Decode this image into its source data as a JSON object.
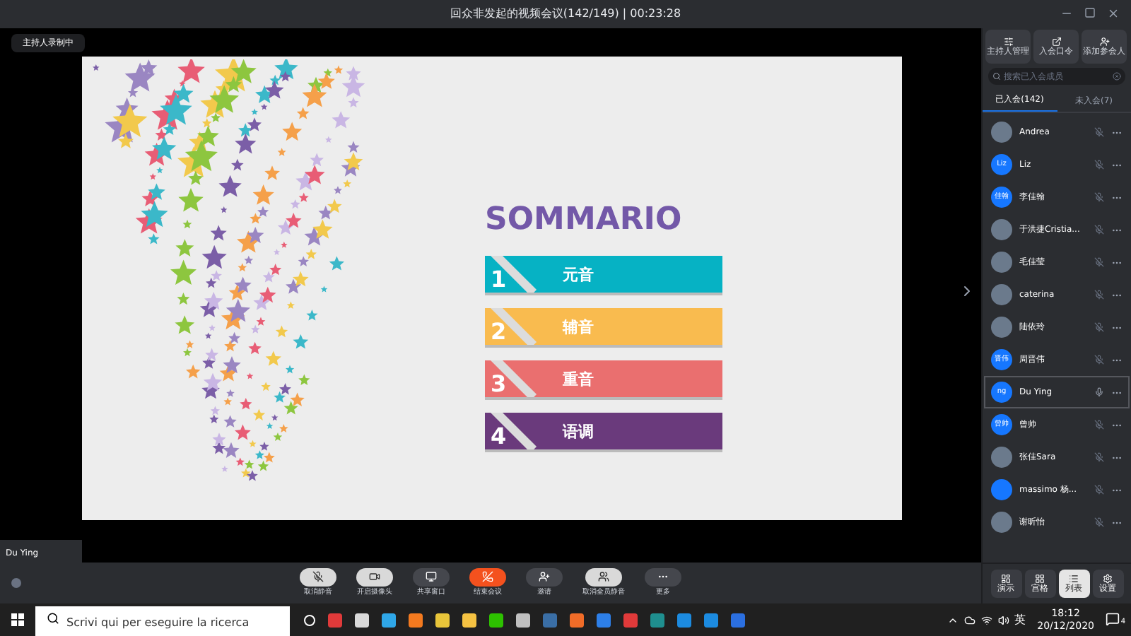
{
  "window": {
    "title": "回众非发起的视频会议(142/149) | 00:23:28"
  },
  "recording_badge": "主持人录制中",
  "slide": {
    "title": "SOMMARIO",
    "items": [
      {
        "number": "1",
        "label": "元音",
        "color": "#06b2c4"
      },
      {
        "number": "2",
        "label": "辅音",
        "color": "#f9bb4f"
      },
      {
        "number": "3",
        "label": "重音",
        "color": "#ea6f6f"
      },
      {
        "number": "4",
        "label": "语调",
        "color": "#6a3a7c"
      }
    ]
  },
  "speaker_name": "Du Ying",
  "toolbar": [
    {
      "kind": "mic",
      "label": "取消静音"
    },
    {
      "kind": "camera",
      "label": "开启摄像头"
    },
    {
      "kind": "share",
      "label": "共享窗口"
    },
    {
      "kind": "end",
      "label": "结束会议"
    },
    {
      "kind": "invite",
      "label": "邀请"
    },
    {
      "kind": "muteall",
      "label": "取消全员静音"
    },
    {
      "kind": "more",
      "label": "更多"
    }
  ],
  "sidebar": {
    "actions": [
      "主持人管理",
      "入会口令",
      "添加参会人"
    ],
    "search": {
      "placeholder": "搜索已入会成员"
    },
    "tabs": [
      {
        "label": "已入会(142)",
        "selected": true
      },
      {
        "label": "未入会(7)",
        "selected": false
      }
    ],
    "participants": [
      {
        "name": "Andrea",
        "avatar": {
          "kind": "photo"
        },
        "muted": true,
        "selected": false
      },
      {
        "name": "Liz",
        "avatar": {
          "kind": "initials",
          "initials": "Liz"
        },
        "muted": true,
        "selected": false
      },
      {
        "name": "李佳翰",
        "avatar": {
          "kind": "initials",
          "initials": "佳翰"
        },
        "muted": true,
        "selected": false
      },
      {
        "name": "于洪捷Cristia...",
        "avatar": {
          "kind": "photo"
        },
        "muted": true,
        "selected": false
      },
      {
        "name": "毛佳莹",
        "avatar": {
          "kind": "photo"
        },
        "muted": true,
        "selected": false
      },
      {
        "name": "caterina",
        "avatar": {
          "kind": "photo"
        },
        "muted": true,
        "selected": false
      },
      {
        "name": "陆依玲",
        "avatar": {
          "kind": "photo"
        },
        "muted": true,
        "selected": false
      },
      {
        "name": "周晋伟",
        "avatar": {
          "kind": "initials",
          "initials": "晋伟"
        },
        "muted": true,
        "selected": false
      },
      {
        "name": "Du Ying",
        "avatar": {
          "kind": "initials",
          "initials": "ng"
        },
        "muted": false,
        "selected": true
      },
      {
        "name": "曾帅",
        "avatar": {
          "kind": "initials",
          "initials": "曾帅"
        },
        "muted": true,
        "selected": false
      },
      {
        "name": "张佳Sara",
        "avatar": {
          "kind": "photo"
        },
        "muted": true,
        "selected": false
      },
      {
        "name": "massimo 杨...",
        "avatar": {
          "kind": "blank"
        },
        "muted": true,
        "selected": false
      },
      {
        "name": "谢昕怡",
        "avatar": {
          "kind": "photo"
        },
        "muted": true,
        "selected": false
      }
    ],
    "views": [
      {
        "kind": "speaker",
        "label": "演示",
        "selected": false
      },
      {
        "kind": "grid",
        "label": "宫格",
        "selected": false
      },
      {
        "kind": "list",
        "label": "列表",
        "selected": true
      },
      {
        "kind": "settings",
        "label": "设置",
        "selected": false
      }
    ]
  },
  "taskbar": {
    "search": {
      "placeholder": "Scrivi qui per eseguire la ricerca"
    },
    "language": "英",
    "time": "18:12",
    "date": "20/12/2020",
    "notifications": "4"
  }
}
